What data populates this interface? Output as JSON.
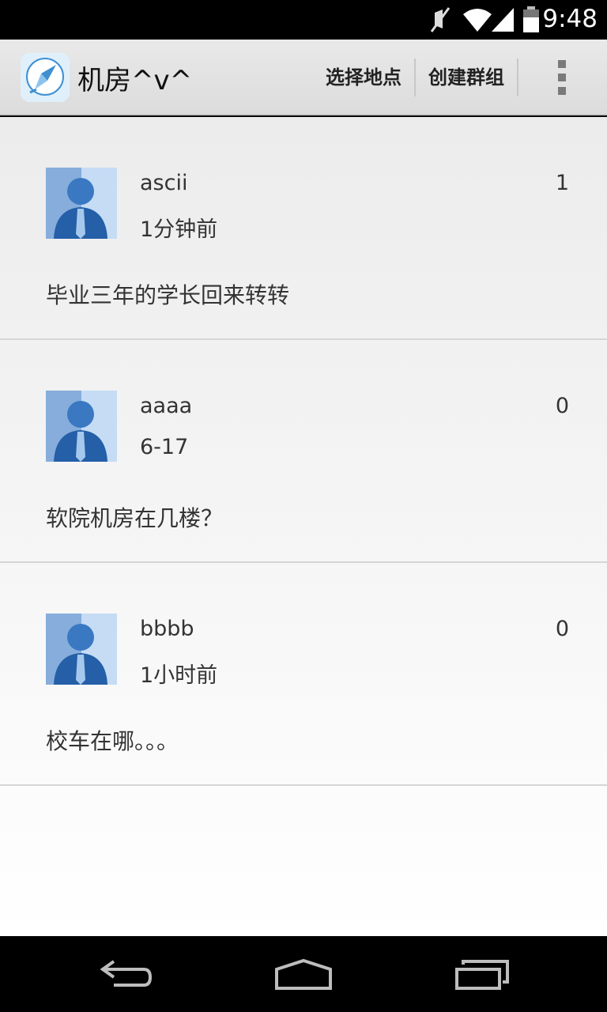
{
  "status_bar": {
    "time": "9:48",
    "icons": [
      "mute-icon",
      "wifi-icon",
      "signal-icon",
      "battery-icon"
    ]
  },
  "action_bar": {
    "app_icon": "compass-icon",
    "title": "机房^v^",
    "actions": [
      "选择地点",
      "创建群组"
    ],
    "overflow_icon": "overflow-menu-icon"
  },
  "posts": [
    {
      "username": "ascii",
      "time": "1分钟前",
      "count": "1",
      "message": "毕业三年的学长回来转转"
    },
    {
      "username": "aaaa",
      "time": "6-17",
      "count": "0",
      "message": "软院机房在几楼？"
    },
    {
      "username": "bbbb",
      "time": "1小时前",
      "count": "0",
      "message": "校车在哪。。。"
    }
  ],
  "nav_bar": {
    "icons": [
      "back-icon",
      "home-icon",
      "recent-apps-icon"
    ]
  },
  "colors": {
    "action_bar": "#e0e0e0",
    "content_bg": "#f2f2f2",
    "avatar_blue": "#3b78c2"
  }
}
